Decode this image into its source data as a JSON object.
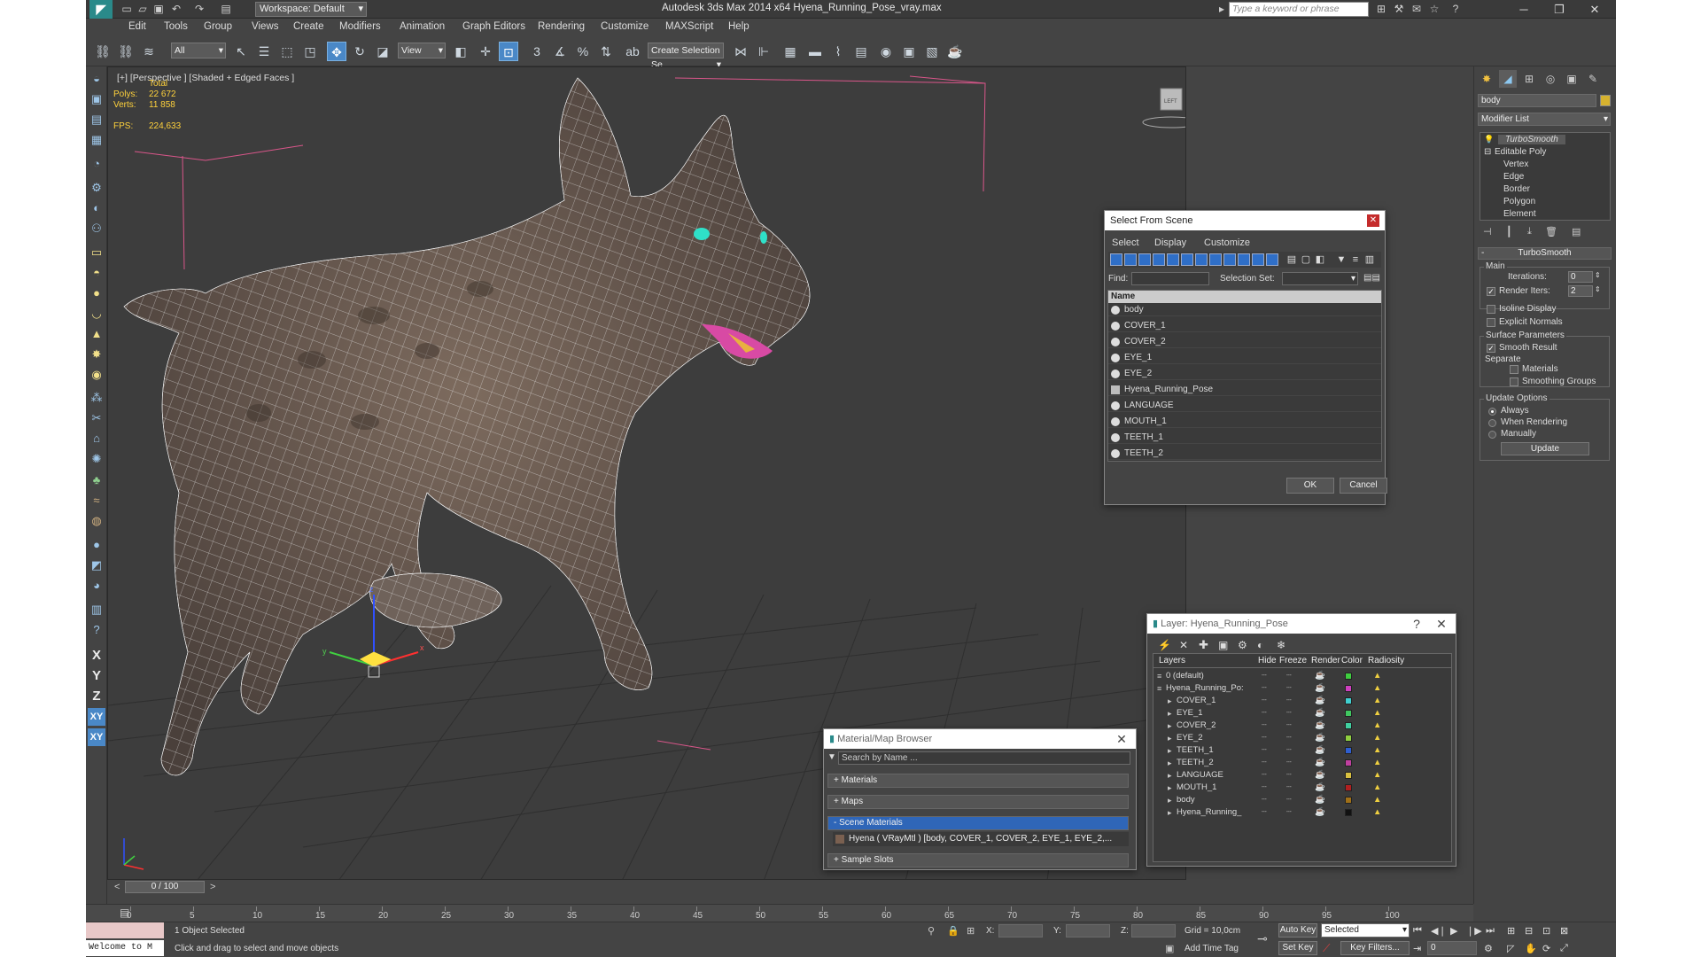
{
  "app": {
    "title": "Autodesk 3ds Max  2014 x64     Hyena_Running_Pose_vray.max",
    "workspace": "Workspace: Default",
    "search_placeholder": "Type a keyword or phrase"
  },
  "menu": [
    "Edit",
    "Tools",
    "Group",
    "Views",
    "Create",
    "Modifiers",
    "Animation",
    "Graph Editors",
    "Rendering",
    "Customize",
    "MAXScript",
    "Help"
  ],
  "toolbar": {
    "selection_filter": "All",
    "ref_coord": "View",
    "named_selection": "Create Selection Se",
    "snap_labels": [
      "3",
      "%"
    ]
  },
  "viewport": {
    "label": "[+] [Perspective ] [Shaded + Edged Faces ]",
    "stats": {
      "total_label": "Total",
      "polys_label": "Polys:",
      "polys": "22 672",
      "verts_label": "Verts:",
      "verts": "11 858",
      "fps_label": "FPS:",
      "fps": "224,633"
    },
    "gizmo_axes": [
      "x",
      "y",
      "z"
    ],
    "viewcube_label": "LEFT"
  },
  "left_axes": [
    "X",
    "Y",
    "Z",
    "XY",
    "XY"
  ],
  "command_panel": {
    "object_name": "body",
    "object_color": "#d6b22f",
    "modifier_list": "Modifier List",
    "stack": [
      "TurboSmooth",
      "Editable Poly",
      "Vertex",
      "Edge",
      "Border",
      "Polygon",
      "Element"
    ],
    "rollout_title": "TurboSmooth",
    "main_label": "Main",
    "iterations_label": "Iterations:",
    "iterations": "0",
    "render_iters_label": "Render Iters:",
    "render_iters": "2",
    "isoline": "Isoline Display",
    "explicit_normals": "Explicit Normals",
    "surface_params": "Surface Parameters",
    "smooth_result": "Smooth Result",
    "separate": "Separate",
    "materials": "Materials",
    "smoothing_groups": "Smoothing Groups",
    "update_options": "Update Options",
    "always": "Always",
    "when_rendering": "When Rendering",
    "manually": "Manually",
    "update_btn": "Update"
  },
  "select_from_scene": {
    "title": "Select From Scene",
    "menu": [
      "Select",
      "Display",
      "Customize"
    ],
    "find_label": "Find:",
    "selection_set_label": "Selection Set:",
    "column": "Name",
    "items": [
      "body",
      "COVER_1",
      "COVER_2",
      "EYE_1",
      "EYE_2",
      "Hyena_Running_Pose",
      "LANGUAGE",
      "MOUTH_1",
      "TEETH_1",
      "TEETH_2"
    ],
    "ok": "OK",
    "cancel": "Cancel"
  },
  "layer_dialog": {
    "title": "Layer: Hyena_Running_Pose",
    "help": "?",
    "columns": [
      "Layers",
      "Hide",
      "Freeze",
      "Render",
      "Color",
      "Radiosity"
    ],
    "rows": [
      {
        "name": "0 (default)",
        "color": "#3fcf3f"
      },
      {
        "name": "Hyena_Running_Po:",
        "color": "#d040c0"
      },
      {
        "name": "COVER_1",
        "color": "#40d0d0"
      },
      {
        "name": "EYE_1",
        "color": "#40c860"
      },
      {
        "name": "COVER_2",
        "color": "#40d0a0"
      },
      {
        "name": "EYE_2",
        "color": "#90d040"
      },
      {
        "name": "TEETH_1",
        "color": "#2f5fd0"
      },
      {
        "name": "TEETH_2",
        "color": "#c040a0"
      },
      {
        "name": "LANGUAGE",
        "color": "#d8c040"
      },
      {
        "name": "MOUTH_1",
        "color": "#b02020"
      },
      {
        "name": "body",
        "color": "#a07018"
      },
      {
        "name": "Hyena_Running_",
        "color": "#111111"
      }
    ]
  },
  "material_browser": {
    "title": "Material/Map Browser",
    "search_placeholder": "Search by Name ...",
    "sections": [
      "+ Materials",
      "+ Maps",
      "- Scene Materials",
      "+ Sample Slots"
    ],
    "scene_material": "Hyena  ( VRayMtl )  [body, COVER_1, COVER_2, EYE_1, EYE_2,..."
  },
  "timeline": {
    "frame": "0 / 100",
    "ticks": [
      "0",
      "5",
      "10",
      "15",
      "20",
      "25",
      "30",
      "35",
      "40",
      "45",
      "50",
      "55",
      "60",
      "65",
      "70",
      "75",
      "80",
      "85",
      "90",
      "95",
      "100"
    ]
  },
  "status": {
    "listener": "Welcome to M",
    "selected": "1 Object Selected",
    "prompt": "Click and drag to select and move objects",
    "x_label": "X:",
    "y_label": "Y:",
    "z_label": "Z:",
    "grid": "Grid = 10,0cm",
    "add_time_tag": "Add Time Tag",
    "auto_key": "Auto Key",
    "auto_key_mode": "Selected",
    "set_key": "Set Key",
    "key_filters": "Key Filters...",
    "current_frame": "0"
  }
}
